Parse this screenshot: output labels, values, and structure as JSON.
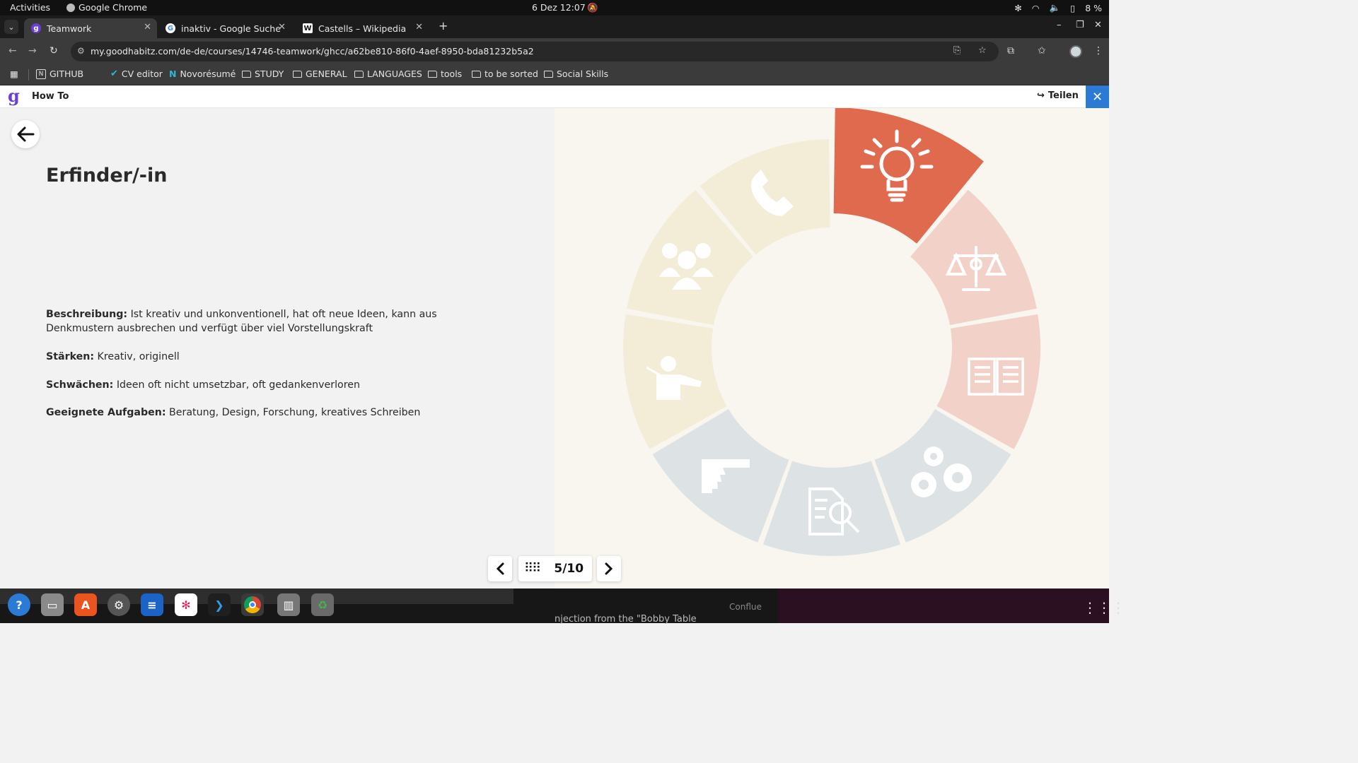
{
  "topbar": {
    "activities": "Activities",
    "app_name": "Google Chrome",
    "clock": "6 Dez  12:07",
    "battery": "8 %"
  },
  "tabs": [
    {
      "label": "Teamwork",
      "icon": "goodhabitz-icon"
    },
    {
      "label": "inaktiv - Google Suche",
      "icon": "google-icon"
    },
    {
      "label": "Castells – Wikipedia",
      "icon": "wikipedia-icon"
    }
  ],
  "toolbar": {
    "url": "my.goodhabitz.com/de-de/courses/14746-teamwork/ghcc/a62be810-86f0-4aef-8950-bda81232b5a2"
  },
  "bookmarks": [
    {
      "label": "GITHUB",
      "icon": "notion-icon"
    },
    {
      "label": "CV editor",
      "icon": "check-circle-icon"
    },
    {
      "label": "Novorésumé",
      "icon": "novoresume-icon"
    },
    {
      "label": "STUDY",
      "icon": "folder-icon"
    },
    {
      "label": "GENERAL",
      "icon": "folder-icon"
    },
    {
      "label": "LANGUAGES",
      "icon": "folder-icon"
    },
    {
      "label": "tools",
      "icon": "folder-icon"
    },
    {
      "label": "to be sorted",
      "icon": "folder-icon"
    },
    {
      "label": "Social Skills",
      "icon": "folder-icon"
    }
  ],
  "header": {
    "title": "How To",
    "share_label": "Teilen"
  },
  "content": {
    "role_title": "Erfinder/-in",
    "description_label": "Beschreibung:",
    "description": "Ist kreativ und unkonventionell, hat oft neue Ideen, kann aus Denkmustern ausbrechen und verfügt über viel Vorstellungskraft",
    "strengths_label": "Stärken:",
    "strengths": "Kreativ, originell",
    "weaknesses_label": "Schwächen:",
    "weaknesses": "Ideen oft nicht umsetzbar, oft gedankenverloren",
    "tasks_label": "Geeignete Aufgaben:",
    "tasks": "Beratung, Design, Forschung, kreatives Schreiben"
  },
  "pagination": {
    "current": "5/10"
  },
  "wheel": {
    "segments": [
      {
        "icon": "lightbulb-icon",
        "color": "#e06a4e",
        "active": true
      },
      {
        "icon": "scales-icon",
        "color": "#f2d2c8"
      },
      {
        "icon": "book-icon",
        "color": "#f2d2c8"
      },
      {
        "icon": "gears-icon",
        "color": "#dde3e4"
      },
      {
        "icon": "document-search-icon",
        "color": "#dde3e4"
      },
      {
        "icon": "pointing-hand-icon",
        "color": "#dde3e4"
      },
      {
        "icon": "presenter-icon",
        "color": "#f3ecd6"
      },
      {
        "icon": "group-icon",
        "color": "#f3ecd6"
      },
      {
        "icon": "phone-icon",
        "color": "#f3ecd6"
      }
    ]
  },
  "dock": {
    "bg_text": "njection from the \"Bobby Table",
    "bg_text2": "Conflue"
  }
}
